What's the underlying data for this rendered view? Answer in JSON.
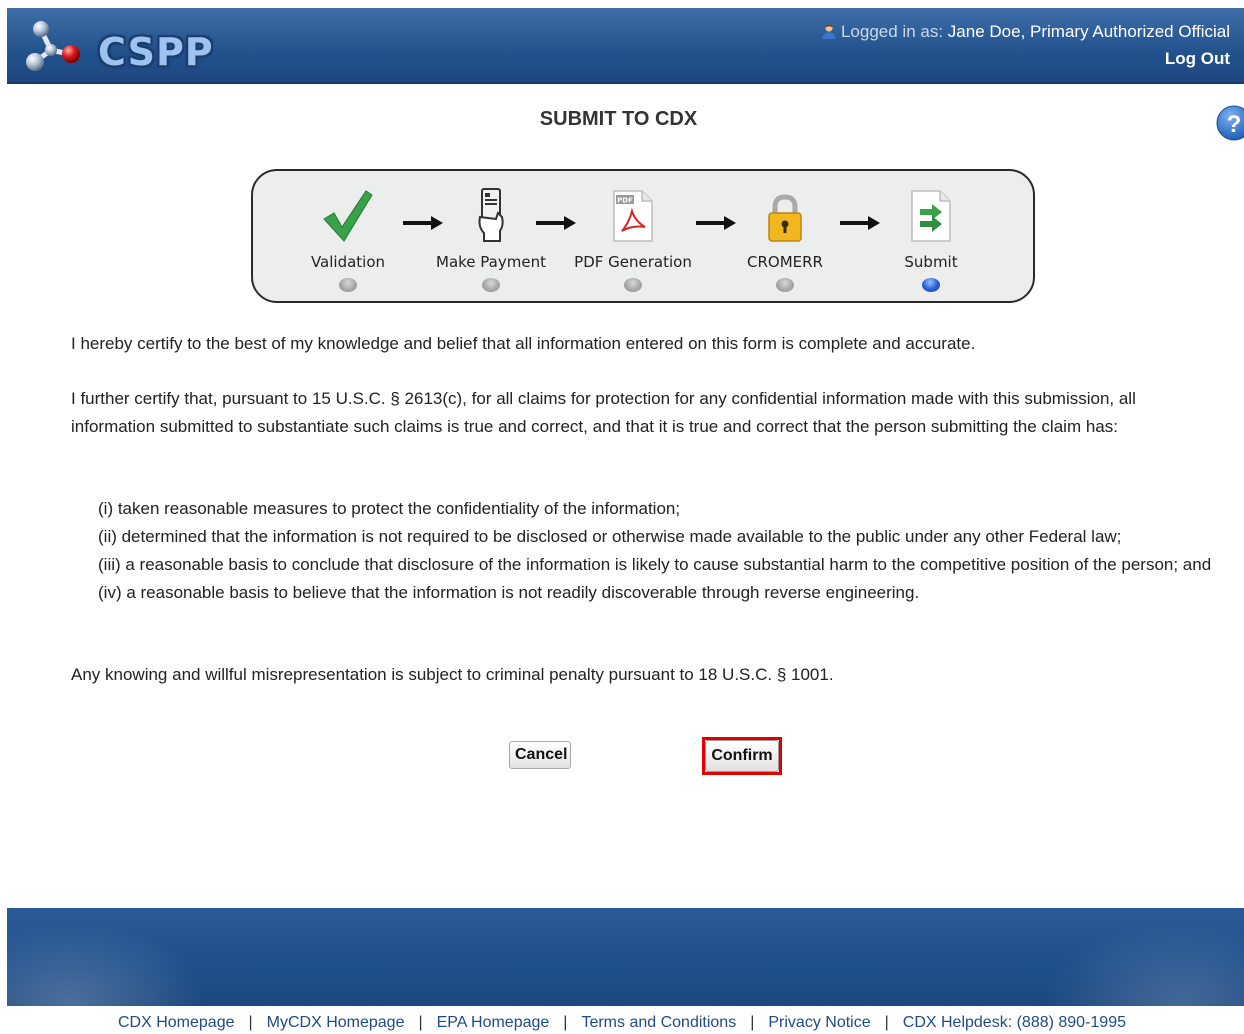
{
  "header": {
    "logo_text": "CSPP",
    "logged_in_label": "Logged in as:",
    "user_name": "Jane Doe, Primary Authorized Official",
    "logout_label": "Log Out"
  },
  "page": {
    "title": "SUBMIT TO CDX"
  },
  "steps": [
    {
      "label": "Validation",
      "icon": "checkmark-icon",
      "active": false
    },
    {
      "label": "Make Payment",
      "icon": "payment-card-icon",
      "active": false
    },
    {
      "label": "PDF Generation",
      "icon": "pdf-icon",
      "active": false
    },
    {
      "label": "CROMERR",
      "icon": "lock-icon",
      "active": false
    },
    {
      "label": "Submit",
      "icon": "submit-arrow-icon",
      "active": true
    }
  ],
  "certification": {
    "p1": "I hereby certify to the best of my knowledge and belief that all information entered on this form is complete and accurate.",
    "p2": "I further certify that, pursuant to 15 U.S.C. § 2613(c), for all claims for protection for any confidential information made with this submission, all information submitted to substantiate such claims is true and correct, and that it is true and correct that the person submitting the claim has:",
    "items": [
      "(i) taken reasonable measures to protect the confidentiality of the information;",
      "(ii) determined that the information is not required to be disclosed or otherwise made available to the public under any other Federal law;",
      "(iii) a reasonable basis to conclude that disclosure of the information is likely to cause substantial harm to the competitive position of the person; and",
      "(iv) a reasonable basis to believe that the information is not readily discoverable through reverse engineering."
    ],
    "p3": "Any knowing and willful misrepresentation is subject to criminal penalty pursuant to 18 U.S.C. § 1001."
  },
  "buttons": {
    "cancel": "Cancel",
    "confirm": "Confirm"
  },
  "footer": {
    "links": [
      "CDX Homepage",
      "MyCDX Homepage",
      "EPA Homepage",
      "Terms and Conditions",
      "Privacy Notice",
      "CDX Helpdesk: (888) 890-1995"
    ],
    "separator": "|"
  },
  "colors": {
    "header_blue": "#24538e",
    "confirm_highlight": "#e00000",
    "active_dot": "#2c63d8"
  }
}
